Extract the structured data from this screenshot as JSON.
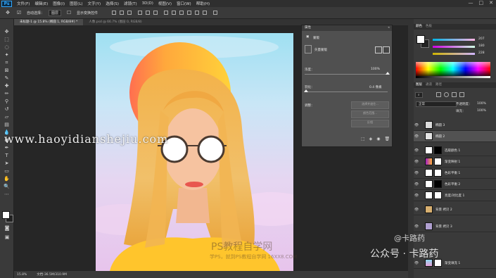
{
  "app": {
    "logo": "Ps",
    "menu": [
      "文件(F)",
      "编辑(E)",
      "图像(I)",
      "图层(L)",
      "文字(Y)",
      "选择(S)",
      "滤镜(T)",
      "3D(D)",
      "视图(V)",
      "窗口(W)",
      "帮助(H)"
    ],
    "window_controls": [
      "—",
      "□",
      "✕"
    ]
  },
  "options_bar": {
    "auto_select_label": "自动选择：",
    "auto_select_value": "图层",
    "show_transform_label": "显示变换控件"
  },
  "tabs": [
    {
      "label": "未标题-1 @ 15.8% (椭圆 1, RGB/8#) *",
      "active": true
    },
    {
      "label": "人像.psd @ 66.7% (图层 0, RGB/8)",
      "active": false
    }
  ],
  "status_bar": {
    "zoom": "15.8%",
    "doc": "文档:36.5M/310.9M"
  },
  "properties": {
    "title": "属性",
    "subtitle": "蒙版",
    "mask_type": "矢量蒙版",
    "density_label": "浓度：",
    "density_value": "100%",
    "feather_label": "羽化：",
    "feather_value": "0.4 像素",
    "refine_label": "调整：",
    "btn_select_mask": "选择并遮住...",
    "btn_color_range": "颜色范围...",
    "btn_invert": "反相"
  },
  "right_panel": {
    "color_tabs": [
      "颜色",
      "色板"
    ],
    "rgb_values": [
      "207",
      "180",
      "228"
    ],
    "layers_tabs": [
      "图层",
      "通道",
      "路径"
    ],
    "blend_mode": "正常",
    "opacity_label": "不透明度：",
    "opacity_value": "100%",
    "fill_label": "填充：",
    "fill_value": "100%",
    "layers": [
      {
        "name": "椭圆 3",
        "selected": false,
        "thumb": "#dcdcdc",
        "mask": ""
      },
      {
        "name": "椭圆 2",
        "selected": true,
        "thumb": "#e4e4e4",
        "mask": ""
      },
      {
        "name": "选取颜色 1",
        "selected": false,
        "thumb": "#ffffff",
        "mask": "#000000"
      },
      {
        "name": "渐变映射 1",
        "selected": false,
        "thumb": "#e040c0",
        "mask": "#ffffff"
      },
      {
        "name": "色彩平衡 1",
        "selected": false,
        "thumb": "#ffffff",
        "mask": "#ffffff"
      },
      {
        "name": "色彩平衡 2",
        "selected": false,
        "thumb": "#ffffff",
        "mask": "#000000"
      },
      {
        "name": "亮度/对比度 1",
        "selected": false,
        "thumb": "#ffffff",
        "mask": "#ffffff"
      },
      {
        "name": "背景 拷贝 2",
        "selected": false,
        "thumb": "#d8b070",
        "mask": ""
      },
      {
        "name": "背景 拷贝 3",
        "selected": false,
        "thumb": "#b0a0d0",
        "mask": ""
      },
      {
        "name": "渐变填充 1",
        "selected": false,
        "thumb": "#e8a0d8",
        "mask": "#ffffff"
      }
    ]
  },
  "watermarks": {
    "url": "www.haoyidianshejiu.com",
    "ps_site": "PS教程自学网",
    "ps_site_small": "学PS，就到PS教程自学网 16XX8.COM",
    "wechat": "公众号 · 卡路药",
    "wechat_top": "@卡路药"
  }
}
